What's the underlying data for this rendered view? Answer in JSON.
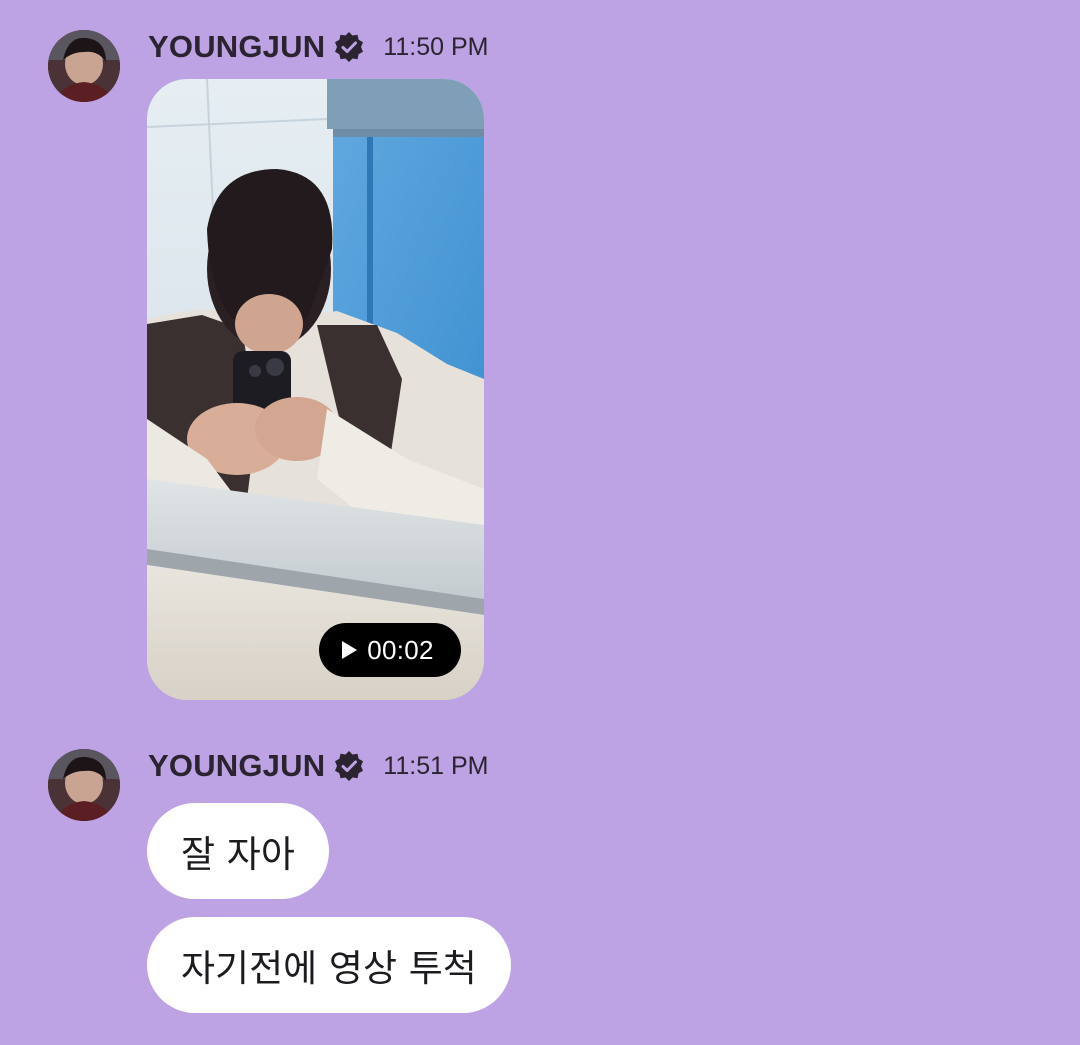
{
  "colors": {
    "background": "#bda2e4",
    "bubble": "#ffffff",
    "text": "#2b2430",
    "duration_pill": "#000000"
  },
  "messages": [
    {
      "sender": "YOUNGJUN",
      "verified": true,
      "time": "11:50 PM",
      "video": {
        "duration": "00:02",
        "icon": "play-icon"
      }
    },
    {
      "sender": "YOUNGJUN",
      "verified": true,
      "time": "11:51 PM",
      "texts": [
        "잘 자아",
        "자기전에 영상 투척"
      ]
    }
  ]
}
